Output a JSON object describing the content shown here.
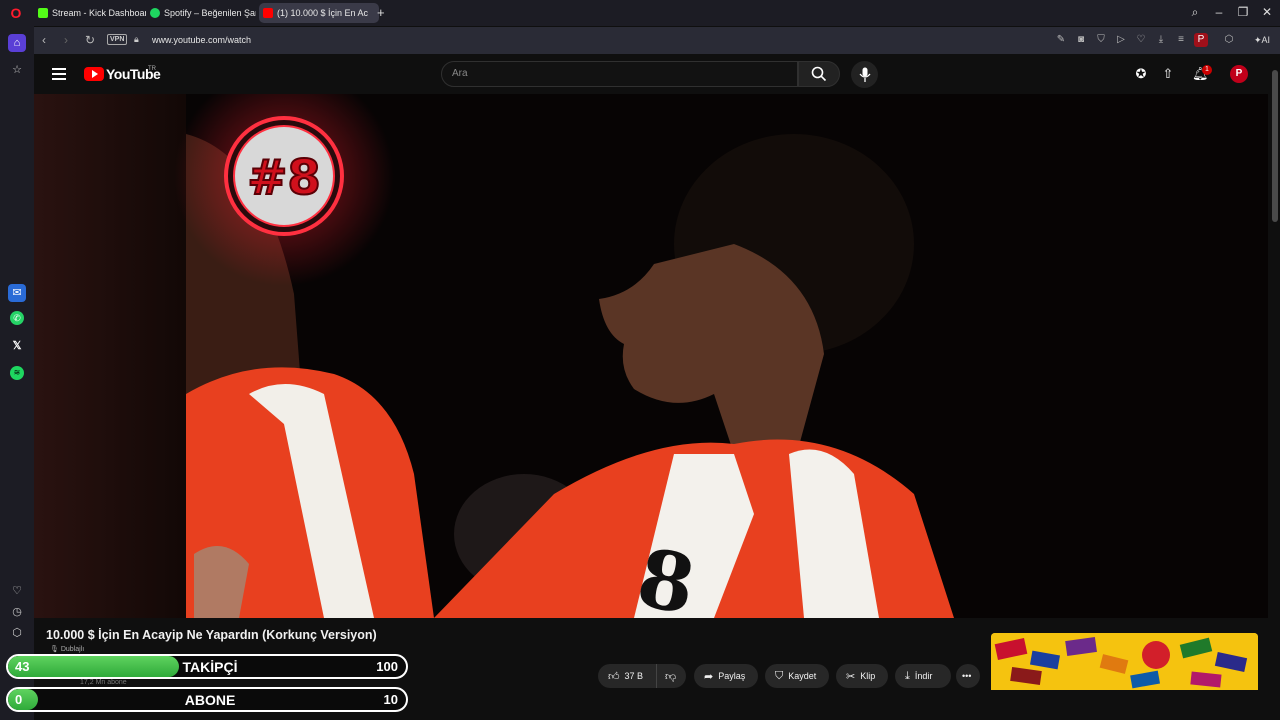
{
  "browser": {
    "tabs": [
      {
        "label": "Stream - Kick Dashboard",
        "favicon_color": "#53fc18"
      },
      {
        "label": "Spotify – Beğenilen Şarkıl",
        "favicon_color": "#1ed760"
      },
      {
        "label": "(1) 10.000 $ İçin En Ac",
        "favicon_color": "#ff0000",
        "active": true
      }
    ],
    "url": "www.youtube.com/watch",
    "vpn_label": "VPN",
    "ai_label": "AI"
  },
  "youtube": {
    "logo_text": "YouTube",
    "region": "TR",
    "search_placeholder": "Ara",
    "notification_count": "1",
    "avatar_letter": "P"
  },
  "video": {
    "title": "10.000 $ İçin En Acayip Ne Yapardın (Korkunç Versiyon)",
    "dubbed_label": "Dublajlı",
    "subscriber_text": "17,2 Mn abone",
    "badge_text": "#8"
  },
  "actions": {
    "like_count": "37 B",
    "share_label": "Paylaş",
    "save_label": "Kaydet",
    "clip_label": "Klip",
    "download_label": "İndir"
  },
  "overlay": {
    "followers": {
      "current": "43",
      "label": "TAKİPÇİ",
      "goal": "100",
      "progress": 0.43
    },
    "subscribers": {
      "current": "0",
      "label": "ABONE",
      "goal": "10",
      "progress": 0.0
    }
  },
  "colors": {
    "accent_red": "#ff0000",
    "counter_green": "#3cbf45",
    "opera_red": "#ff1b2d"
  }
}
